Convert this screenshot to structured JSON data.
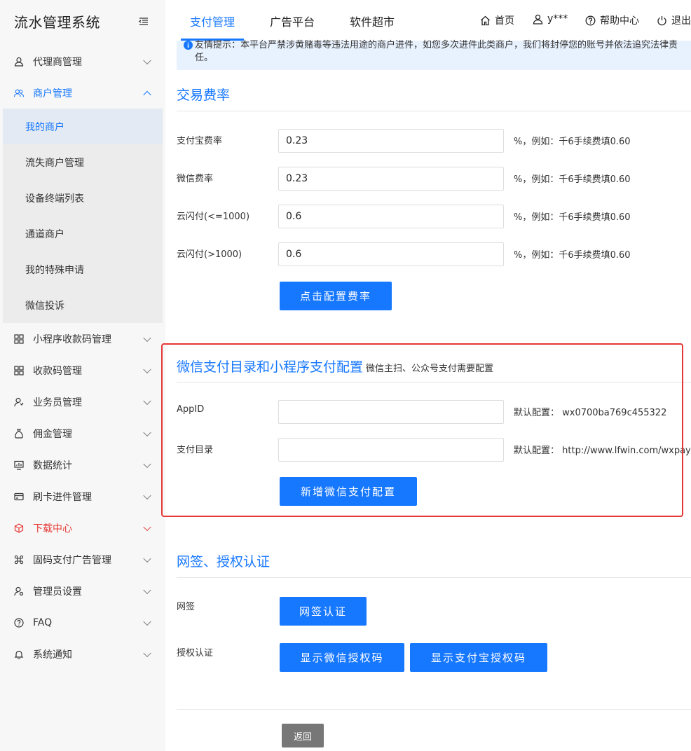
{
  "app": {
    "title": "流水管理系统"
  },
  "topnav": {
    "tabs": [
      {
        "label": "支付管理"
      },
      {
        "label": "广告平台"
      },
      {
        "label": "软件超市"
      }
    ],
    "home": "首页",
    "user": "y***",
    "help": "帮助中心",
    "logout": "退出"
  },
  "sidebar": {
    "items": [
      {
        "label": "代理商管理",
        "icon": "agent-icon"
      },
      {
        "label": "商户管理",
        "icon": "merchants-icon"
      },
      {
        "label": "小程序收款码管理",
        "icon": "grid-icon"
      },
      {
        "label": "收款码管理",
        "icon": "grid-icon"
      },
      {
        "label": "业务员管理",
        "icon": "staff-icon"
      },
      {
        "label": "佣金管理",
        "icon": "money-bag-icon"
      },
      {
        "label": "数据统计",
        "icon": "monitor-icon"
      },
      {
        "label": "刷卡进件管理",
        "icon": "card-icon"
      },
      {
        "label": "下载中心",
        "icon": "cube-icon"
      },
      {
        "label": "固码支付广告管理",
        "icon": "command-icon"
      },
      {
        "label": "管理员设置",
        "icon": "admin-icon"
      },
      {
        "label": "FAQ",
        "icon": "question-icon"
      },
      {
        "label": "系统通知",
        "icon": "bell-icon"
      }
    ],
    "subitems": [
      {
        "label": "我的商户"
      },
      {
        "label": "流失商户管理"
      },
      {
        "label": "设备终端列表"
      },
      {
        "label": "通道商户"
      },
      {
        "label": "我的特殊申请"
      },
      {
        "label": "微信投诉"
      }
    ]
  },
  "notice": {
    "text": "友情提示：本平台严禁涉黄赌毒等违法用途的商户进件，如您多次进件此类商户，我们将封停您的账号并依法追究法律责任。"
  },
  "rates": {
    "title": "交易费率",
    "rows": [
      {
        "label": "支付宝费率",
        "value": "0.23",
        "hint": "%，例如：千6手续费填0.60"
      },
      {
        "label": "微信费率",
        "value": "0.23",
        "hint": "%，例如：千6手续费填0.60"
      },
      {
        "label": "云闪付(<=1000)",
        "value": "0.6",
        "hint": "%，例如：千6手续费填0.60"
      },
      {
        "label": "云闪付(>1000)",
        "value": "0.6",
        "hint": "%，例如：千6手续费填0.60"
      }
    ],
    "button": "点击配置费率"
  },
  "wechat": {
    "title": "微信支付目录和小程序支付配置",
    "subtitle": "微信主扫、公众号支付需要配置",
    "appid_label": "AppID",
    "appid_value": "",
    "appid_default": "默认配置：  wx0700ba769c455322",
    "dir_label": "支付目录",
    "dir_value": "",
    "dir_default": "默认配置：  http://www.lfwin.com/wxpay/",
    "button": "新增微信支付配置"
  },
  "auth": {
    "title": "网签、授权认证",
    "esign_label": "网签",
    "esign_button": "网签认证",
    "auth_label": "授权认证",
    "wx_button": "显示微信授权码",
    "ali_button": "显示支付宝授权码"
  },
  "back_button": "返回",
  "colors": {
    "accent": "#1677ff",
    "danger": "#e53935",
    "notice_bg": "#e8f2ff"
  }
}
